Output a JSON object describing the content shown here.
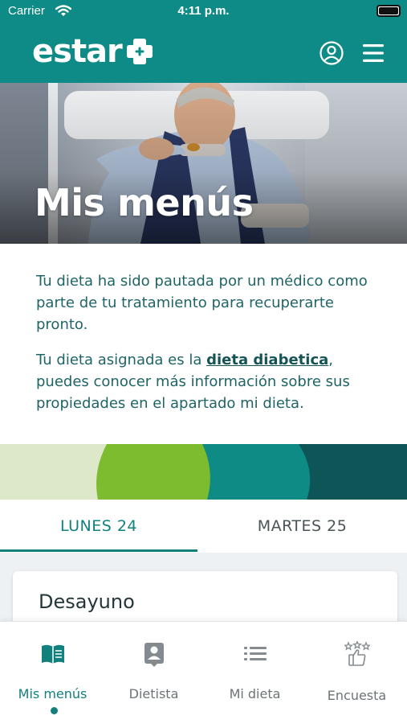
{
  "status_bar": {
    "carrier": "Carrier",
    "time": "4:11 p.m."
  },
  "header": {
    "logo_text": "estar"
  },
  "hero": {
    "title": "Mis menús"
  },
  "intro": {
    "paragraph1": "Tu dieta ha sido pautada por un médico como parte de tu tratamiento para recuperarte pronto.",
    "paragraph2_prefix": "Tu dieta asignada es la ",
    "diet_link": "dieta diabetica",
    "paragraph2_suffix": ", puedes conocer más información sobre sus propiedades en el apartado mi dieta."
  },
  "colors": {
    "brand": "#0e8b86",
    "accent": "#12807d",
    "band_light": "#dde8c8",
    "band_lime": "#7dbb2f",
    "band_teal": "#0f8b86",
    "band_dark": "#0e5558"
  },
  "day_tabs": [
    {
      "label": "LUNES 24",
      "selected": true
    },
    {
      "label": "MARTES 25",
      "selected": false
    }
  ],
  "meal_card": {
    "title": "Desayuno"
  },
  "bottom_nav": [
    {
      "label": "Mis menús",
      "icon": "book-icon",
      "active": true
    },
    {
      "label": "Dietista",
      "icon": "doctor-badge-icon",
      "active": false
    },
    {
      "label": "Mi dieta",
      "icon": "list-icon",
      "active": false
    },
    {
      "label": "Encuesta",
      "icon": "thumbs-up-stars-icon",
      "active": false
    }
  ]
}
